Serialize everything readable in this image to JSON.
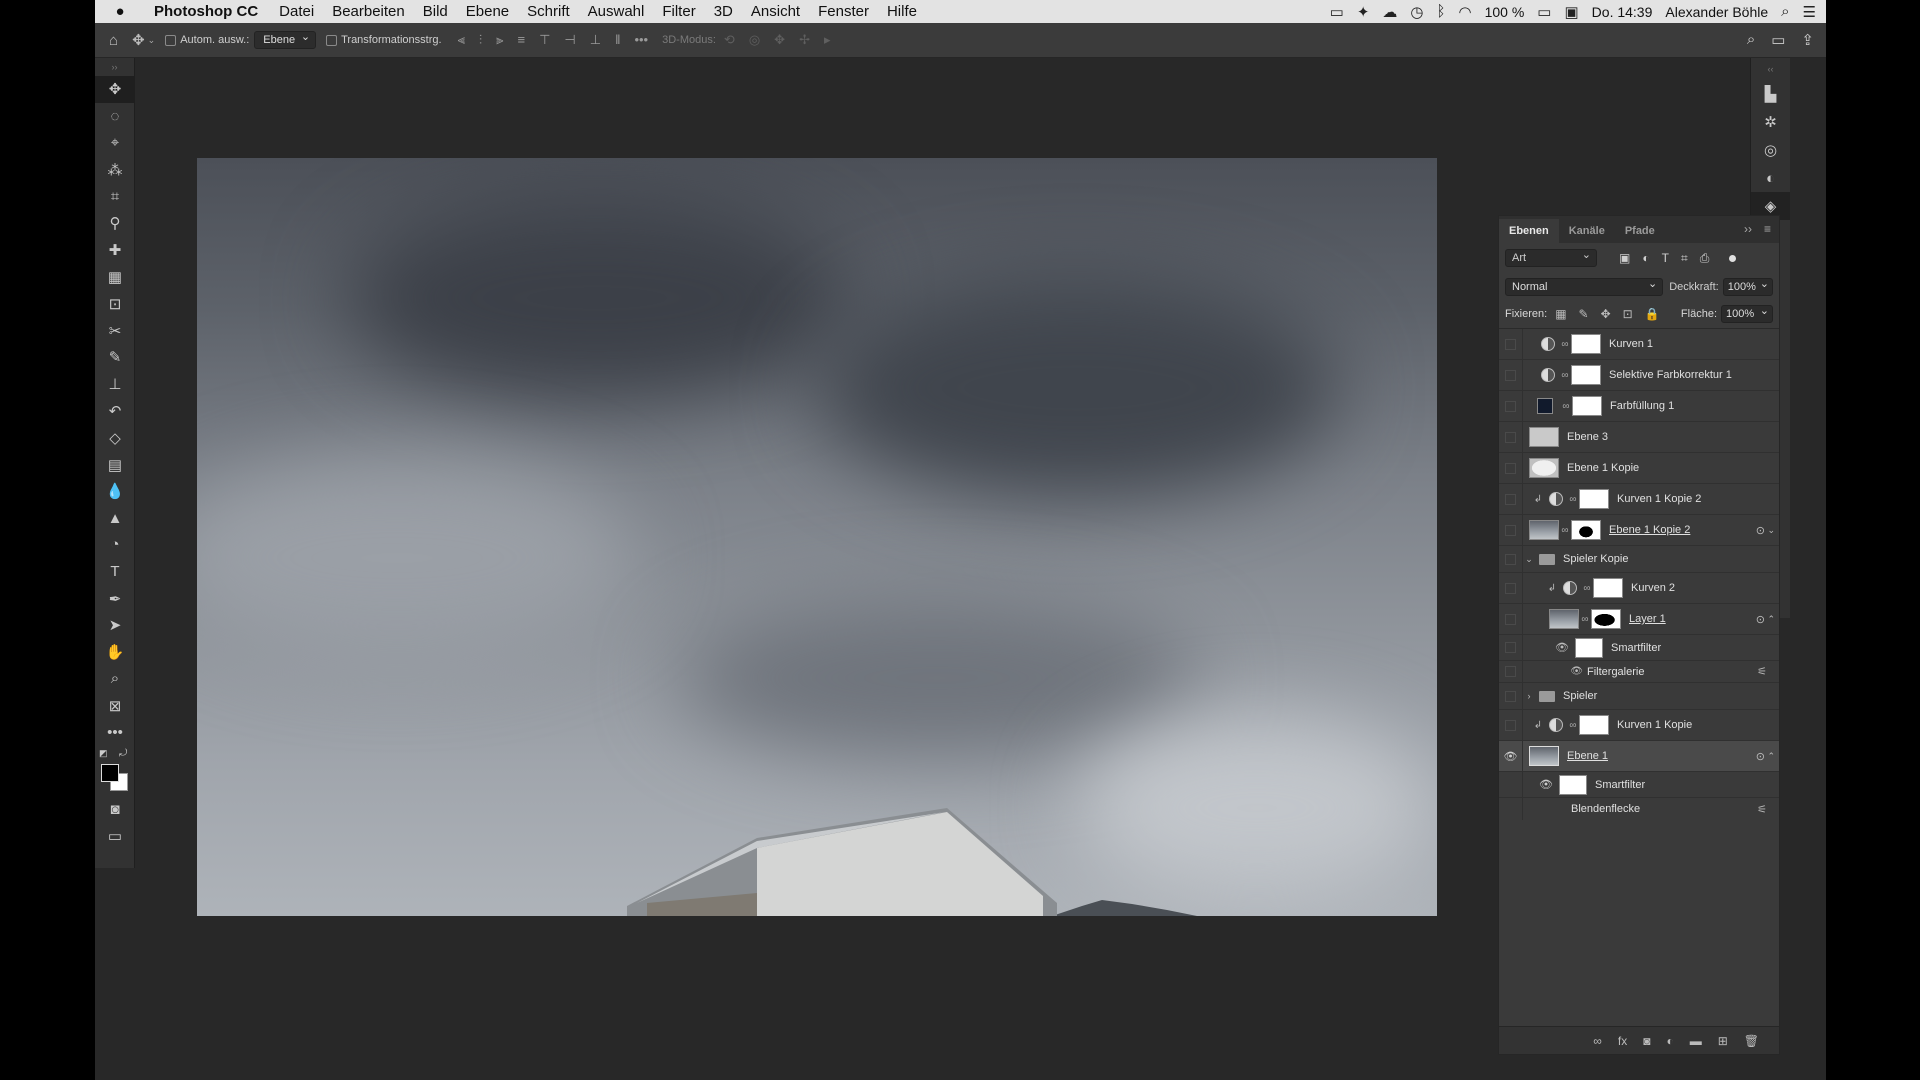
{
  "menubar": {
    "apple": "",
    "app_name": "Photoshop CC",
    "items": [
      "Datei",
      "Bearbeiten",
      "Bild",
      "Ebene",
      "Schrift",
      "Auswahl",
      "Filter",
      "3D",
      "Ansicht",
      "Fenster",
      "Hilfe"
    ],
    "battery": "100 %",
    "clock": "Do. 14:39",
    "user": "Alexander Böhle"
  },
  "optionsbar": {
    "auto_select_label": "Autom. ausw.:",
    "auto_select_value": "Ebene",
    "transform_label": "Transformationsstrg.",
    "mode_label": "3D-Modus:"
  },
  "layers_panel": {
    "tabs": [
      "Ebenen",
      "Kanäle",
      "Pfade"
    ],
    "filter_kind": "Art",
    "blend_mode": "Normal",
    "opacity_label": "Deckkraft:",
    "opacity_value": "100%",
    "lock_label": "Fixieren:",
    "fill_label": "Fläche:",
    "fill_value": "100%",
    "layers": [
      {
        "name": "Kurven 1"
      },
      {
        "name": "Selektive Farbkorrektur 1"
      },
      {
        "name": "Farbfüllung 1"
      },
      {
        "name": "Ebene 3"
      },
      {
        "name": "Ebene 1 Kopie"
      },
      {
        "name": "Kurven 1 Kopie 2"
      },
      {
        "name": "Ebene 1 Kopie 2"
      },
      {
        "name": "Spieler Kopie"
      },
      {
        "name": "Kurven 2"
      },
      {
        "name": "Layer 1"
      },
      {
        "name": "Smartfilter"
      },
      {
        "name": "Filtergalerie"
      },
      {
        "name": "Spieler"
      },
      {
        "name": "Kurven 1 Kopie"
      },
      {
        "name": "Ebene 1"
      },
      {
        "name": "Smartfilter"
      },
      {
        "name": "Blendenflecke"
      }
    ]
  },
  "colors": {
    "accent_bg": "#282828",
    "panel_bg": "#3a3a3a",
    "foreground_color": "#000000",
    "background_color": "#ffffff"
  }
}
